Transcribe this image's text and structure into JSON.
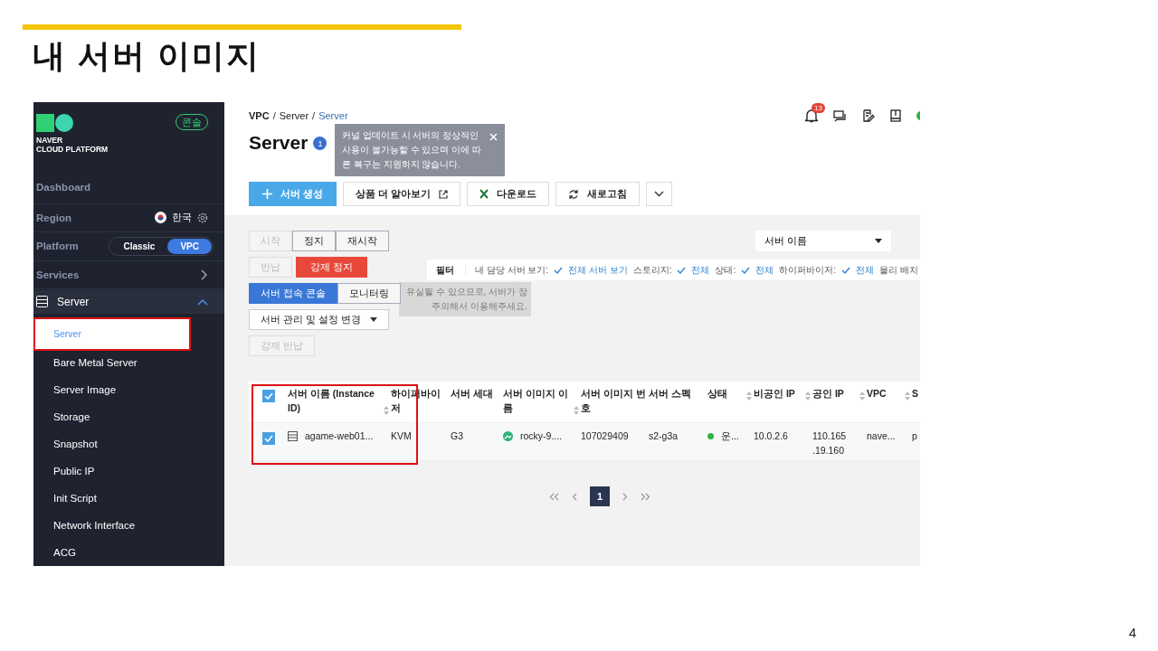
{
  "slide": {
    "title": "내 서버 이미지",
    "page_number": "4"
  },
  "sidebar": {
    "logo_line1": "NAVER",
    "logo_line2": "CLOUD PLATFORM",
    "console_badge": "콘솔",
    "dashboard": "Dashboard",
    "region": {
      "label": "Region",
      "value": "한국"
    },
    "platform": {
      "label": "Platform",
      "options": [
        {
          "label": "Classic",
          "selected": false
        },
        {
          "label": "VPC",
          "selected": true
        }
      ]
    },
    "services": "Services",
    "group": {
      "label": "Server",
      "expanded": true,
      "children": [
        {
          "label": "Server",
          "selected": true
        },
        {
          "label": "Bare Metal Server",
          "selected": false
        },
        {
          "label": "Server Image",
          "selected": false
        },
        {
          "label": "Storage",
          "selected": false
        },
        {
          "label": "Snapshot",
          "selected": false
        },
        {
          "label": "Public IP",
          "selected": false
        },
        {
          "label": "Init Script",
          "selected": false
        },
        {
          "label": "Network Interface",
          "selected": false
        },
        {
          "label": "ACG",
          "selected": false
        }
      ]
    }
  },
  "header": {
    "breadcrumb": [
      {
        "text": "VPC",
        "kind": "root"
      },
      {
        "text": "/",
        "kind": "separator"
      },
      {
        "text": "Server",
        "kind": "link"
      },
      {
        "text": "/",
        "kind": "separator"
      },
      {
        "text": "Server",
        "kind": "current"
      }
    ],
    "notification_count": "13"
  },
  "title": "Server",
  "info_count": "1",
  "notice": "커널 업데이트 시 서버의 정상적인 사용이 불가능할 수 있으며 이에 따른 복구는 지원하지 않습니다.",
  "toolbar": [
    {
      "kind": "create",
      "label": "서버 생성"
    },
    {
      "kind": "link",
      "label": "상품 더 알아보기"
    },
    {
      "kind": "download",
      "label": "다운로드"
    },
    {
      "kind": "refresh",
      "label": "새로고침"
    },
    {
      "kind": "more"
    }
  ],
  "search_select": "서버 이름",
  "action_rows": [
    [
      {
        "label": "시작",
        "kind": "disabled"
      },
      {
        "label": "정지",
        "kind": "normal"
      },
      {
        "label": "재시작",
        "kind": "normal"
      }
    ],
    [
      {
        "label": "반납",
        "kind": "disabled"
      },
      {
        "label": "강제 정지",
        "kind": "danger"
      }
    ],
    [
      {
        "label": "서버 접속 콘솔",
        "kind": "primary"
      },
      {
        "label": "모니터링",
        "kind": "normal"
      }
    ],
    [
      {
        "label": "서버 관리 및 설정 변경",
        "kind": "dropdown"
      }
    ],
    [
      {
        "label": "강제 반납",
        "kind": "disabled"
      }
    ]
  ],
  "hint_lines": [
    "유실될 수 있으므로, 서버가 장",
    "주의해서 이용해주세요."
  ],
  "filter": {
    "label": "필터",
    "items": [
      {
        "name": "내 담당 서버 보기:",
        "value": "전체 서버 보기"
      },
      {
        "name": "스토리지:",
        "value": "전체"
      },
      {
        "name": "상태:",
        "value": "전체"
      },
      {
        "name": "하이퍼바이저:",
        "value": "전체"
      },
      {
        "name": "물리 배치"
      }
    ]
  },
  "table": {
    "all_checked": true,
    "columns": [
      {
        "label": "서버 이름 (Instance ID)",
        "sortable": true
      },
      {
        "label": "하이퍼바이저",
        "sortable": false
      },
      {
        "label": "서버 세대",
        "sortable": false
      },
      {
        "label": "서버 이미지 이름",
        "sortable": true
      },
      {
        "label": "서버 이미지 번호",
        "sortable": false
      },
      {
        "label": "서버 스펙",
        "sortable": false
      },
      {
        "label": "상태",
        "sortable": true
      },
      {
        "label": "비공인 IP",
        "sortable": true
      },
      {
        "label": "공인 IP",
        "sortable": true
      },
      {
        "label": "VPC",
        "sortable": true
      },
      {
        "label": "S",
        "sortable": false
      }
    ],
    "rows": [
      {
        "checked": true,
        "name": "agame-web01...",
        "hypervisor": "KVM",
        "generation": "G3",
        "image_name": "rocky-9....",
        "image_number": "107029409",
        "spec": "s2-g3a",
        "status": "운...",
        "private_ip": "10.0.2.6",
        "public_ip": "110.165 .19.160",
        "vpc": "nave...",
        "column_12": "p"
      }
    ]
  },
  "pagination": {
    "pages": [
      {
        "label": "1",
        "selected": true
      }
    ]
  }
}
